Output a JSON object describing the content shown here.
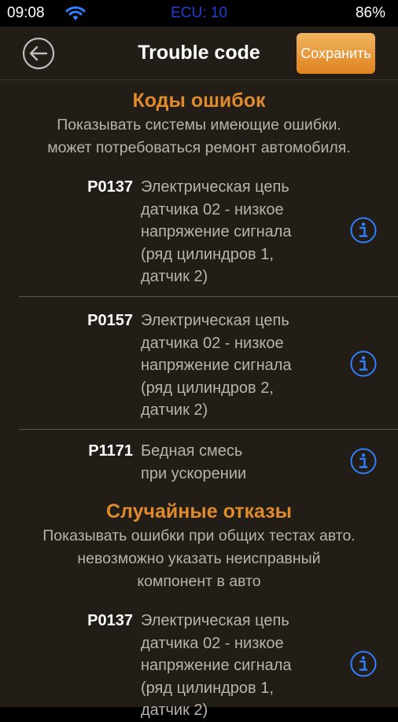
{
  "status_bar": {
    "time": "09:08",
    "ecu": "ECU: 10",
    "battery": "86%"
  },
  "nav": {
    "title": "Trouble code",
    "save_label": "Сохранить",
    "back_icon": "arrow-left-icon"
  },
  "sections": [
    {
      "title": "Коды ошибок",
      "description_lines": [
        "Показывать системы имеющие ошибки.",
        "может потребоваться ремонт автомобиля."
      ],
      "codes": [
        {
          "code": "P0137",
          "description_lines": [
            "Электрическая цепь",
            "датчика 02 - низкое",
            "напряжение сигнала",
            "(ряд цилиндров 1,",
            "датчик 2)"
          ]
        },
        {
          "code": "P0157",
          "description_lines": [
            "Электрическая цепь",
            "датчика 02 - низкое",
            "напряжение сигнала",
            "(ряд цилиндров 2,",
            "датчик 2)"
          ]
        },
        {
          "code": "P1171",
          "description_lines": [
            "Бедная смесь",
            "при ускорении"
          ]
        }
      ]
    },
    {
      "title": "Случайные отказы",
      "description_lines": [
        "Показывать ошибки при общих тестах авто.",
        "невозможно указать неисправный",
        "компонент в авто"
      ],
      "codes": [
        {
          "code": "P0137",
          "description_lines": [
            "Электрическая цепь",
            "датчика 02 - низкое",
            "напряжение сигнала",
            "(ряд цилиндров 1,",
            "датчик 2)"
          ]
        }
      ]
    }
  ],
  "colors": {
    "accent": "#e08a2e",
    "info_icon": "#2f7fff",
    "ecu_text": "#1f3fd6",
    "background": "#221d17"
  }
}
